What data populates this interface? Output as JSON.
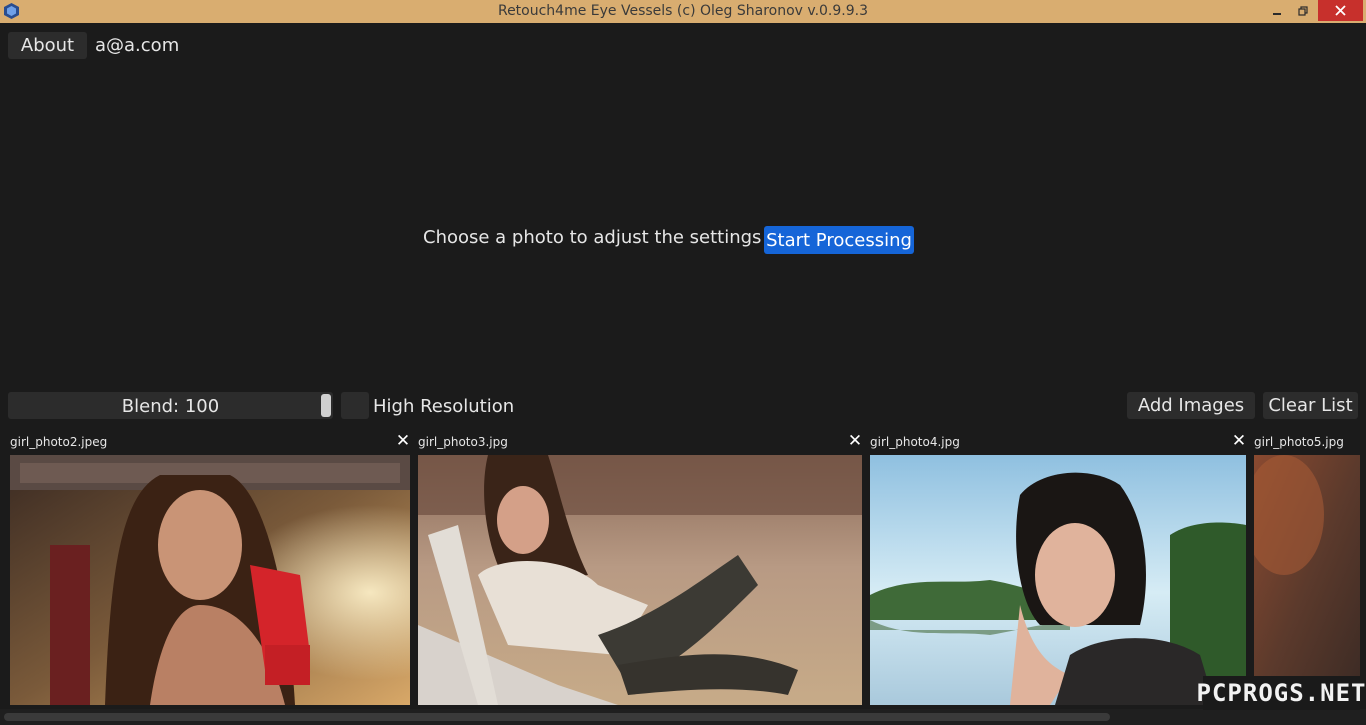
{
  "window": {
    "title": "Retouch4me Eye Vessels (c) Oleg Sharonov v.0.9.9.3",
    "minimize_glyph": "–",
    "close_glyph": "✕"
  },
  "toolbar": {
    "about_label": "About",
    "email": "a@a.com"
  },
  "main": {
    "prompt_text": "Choose a photo to adjust the settings or",
    "start_label": "Start Processing"
  },
  "controls": {
    "blend_label": "Blend: 100",
    "blend_value": 100,
    "high_resolution_label": "High Resolution",
    "high_resolution_checked": false,
    "add_images_label": "Add Images",
    "clear_list_label": "Clear List"
  },
  "thumbnails": [
    {
      "name": "girl_photo2.jpeg"
    },
    {
      "name": "girl_photo3.jpg"
    },
    {
      "name": "girl_photo4.jpg"
    },
    {
      "name": "girl_photo5.jpg"
    }
  ],
  "watermark": "PCPROGS.NET",
  "colors": {
    "title_bar": "#d9ad70",
    "background": "#1b1b1b",
    "button": "#2c2c2c",
    "accent": "#1565d8",
    "close": "#c7302c"
  }
}
